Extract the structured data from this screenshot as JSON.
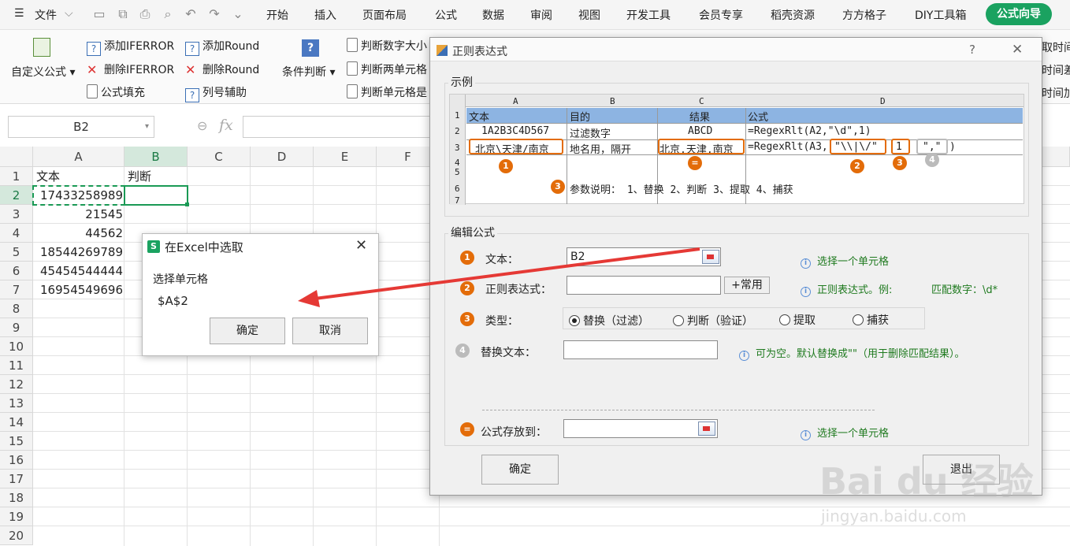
{
  "menubar": {
    "file": "文件",
    "tabs": [
      "开始",
      "插入",
      "页面布局",
      "公式",
      "数据",
      "审阅",
      "视图",
      "开发工具",
      "会员专享",
      "稻壳资源",
      "方方格子",
      "DIY工具箱"
    ],
    "active_tab": "公式向导"
  },
  "ribbon": {
    "custom_formula": "自定义公式",
    "add_iferror": "添加IFERROR",
    "remove_iferror": "删除IFERROR",
    "formula_fill": "公式填充",
    "add_round": "添加Round",
    "remove_round": "删除Round",
    "col_helper": "列号辅助",
    "condition": "条件判断",
    "judge_num_size": "判断数字大小",
    "judge_two_cells": "判断两单元格",
    "judge_cell_is": "判断单元格是",
    "right1": "取时间",
    "right2": "时间差",
    "right3": "时间加"
  },
  "formulabar": {
    "namebox": "B2",
    "fx": "fx"
  },
  "sheet": {
    "columns": [
      "A",
      "B",
      "C",
      "D",
      "E",
      "F"
    ],
    "rows": [
      "1",
      "2",
      "3",
      "4",
      "5",
      "6",
      "7",
      "8",
      "9",
      "10",
      "11",
      "12",
      "13",
      "14",
      "15",
      "16",
      "17",
      "18",
      "19",
      "20"
    ],
    "a1": "文本",
    "b1": "判断",
    "a_values": [
      "17433258989",
      "21545",
      "44562",
      "18544269789",
      "45454544444",
      "16954549696"
    ]
  },
  "pick_dialog": {
    "title": "在Excel中选取",
    "label": "选择单元格",
    "value": "$A$2",
    "ok": "确定",
    "cancel": "取消"
  },
  "regex_dialog": {
    "title": "正则表达式",
    "help": "?",
    "example_legend": "示例",
    "example": {
      "cols": [
        "A",
        "B",
        "C",
        "D"
      ],
      "rows": [
        "1",
        "2",
        "3",
        "4",
        "5",
        "6",
        "7"
      ],
      "header": [
        "文本",
        "目的",
        "结果",
        "公式"
      ],
      "row2": [
        "1A2B3C4D567",
        "过滤数字",
        "ABCD",
        "=RegexRlt(A2,\"\\d\",1)"
      ],
      "row3": [
        "北京\\天津/南京",
        "地名用，隔开",
        "北京,天津,南京",
        "=RegexRlt(A3,",
        "\"\\\\|\\/\"",
        "1",
        "\",\"",
        ")"
      ],
      "param_note": "参数说明： 1、替换 2、判断 3、提取 4、捕获",
      "markers": [
        "1",
        "=",
        "2",
        "3",
        "4",
        "3"
      ]
    },
    "edit_legend": "编辑公式",
    "fields": {
      "text_label": "文本：",
      "text_value": "B2",
      "text_hint": "选择一个单元格",
      "regex_label": "正则表达式：",
      "regex_value": "",
      "common_btn": "+常用",
      "regex_hint": "正则表达式。例:",
      "regex_hint2": "匹配数字：\\d*",
      "type_label": "类型：",
      "types": [
        "替换（过滤）",
        "判断（验证）",
        "提取",
        "捕获"
      ],
      "replace_label": "替换文本：",
      "replace_value": "",
      "replace_hint": "可为空。默认替换成\"\"（用于删除匹配结果）。",
      "store_label": "公式存放到：",
      "store_value": "",
      "store_hint": "选择一个单元格"
    },
    "step_markers": [
      "1",
      "2",
      "3",
      "4",
      "="
    ],
    "ok": "确定",
    "cancel": "退出"
  },
  "watermark": {
    "brand": "Bai du 经验",
    "url": "jingyan.baidu.com"
  }
}
